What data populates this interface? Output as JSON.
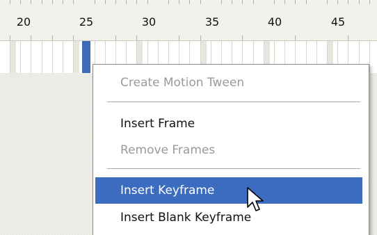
{
  "ruler": {
    "labels": [
      "20",
      "25",
      "30",
      "35",
      "40",
      "45"
    ]
  },
  "context_menu": {
    "items": [
      {
        "label": "Create Motion Tween",
        "enabled": false
      },
      {
        "label": "Insert Frame",
        "enabled": true
      },
      {
        "label": "Remove Frames",
        "enabled": false
      },
      {
        "label": "Insert Keyframe",
        "enabled": true,
        "highlighted": true
      },
      {
        "label": "Insert Blank Keyframe",
        "enabled": true
      }
    ]
  },
  "colors": {
    "highlight": "#3b6cc0",
    "playhead": "#3d6bb8",
    "disabled_text": "#9a9a9a"
  },
  "icons": {
    "cursor": "arrow-pointer-icon"
  }
}
